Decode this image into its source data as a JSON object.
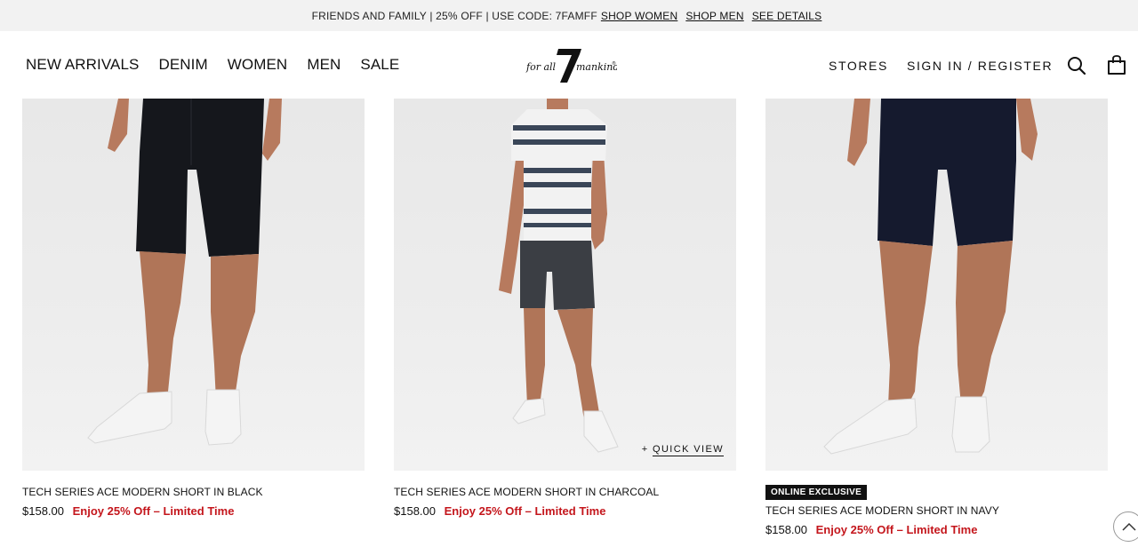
{
  "promo": {
    "text": "FRIENDS AND FAMILY | 25% OFF | USE CODE: 7FAMFF",
    "links": [
      "SHOP WOMEN",
      "SHOP MEN",
      "SEE DETAILS"
    ]
  },
  "header": {
    "nav": [
      "NEW ARRIVALS",
      "DENIM",
      "WOMEN",
      "MEN",
      "SALE"
    ],
    "logo_text": "for all mankind",
    "stores": "STORES",
    "signin": "SIGN IN / REGISTER"
  },
  "products": [
    {
      "name": "TECH SERIES ACE MODERN SHORT IN BLACK",
      "price": "$158.00",
      "promo": "Enjoy 25% Off – Limited Time",
      "badge": ""
    },
    {
      "name": "TECH SERIES ACE MODERN SHORT IN CHARCOAL",
      "price": "$158.00",
      "promo": "Enjoy 25% Off – Limited Time",
      "badge": "",
      "quick_view": "QUICK VIEW"
    },
    {
      "name": "TECH SERIES ACE MODERN SHORT IN NAVY",
      "price": "$158.00",
      "promo": "Enjoy 25% Off – Limited Time",
      "badge": "ONLINE EXCLUSIVE"
    }
  ],
  "colors": {
    "promo_red": "#c4161c",
    "black_short": "#15171c",
    "charcoal_short": "#3b3e44",
    "navy_short": "#151a2e"
  }
}
